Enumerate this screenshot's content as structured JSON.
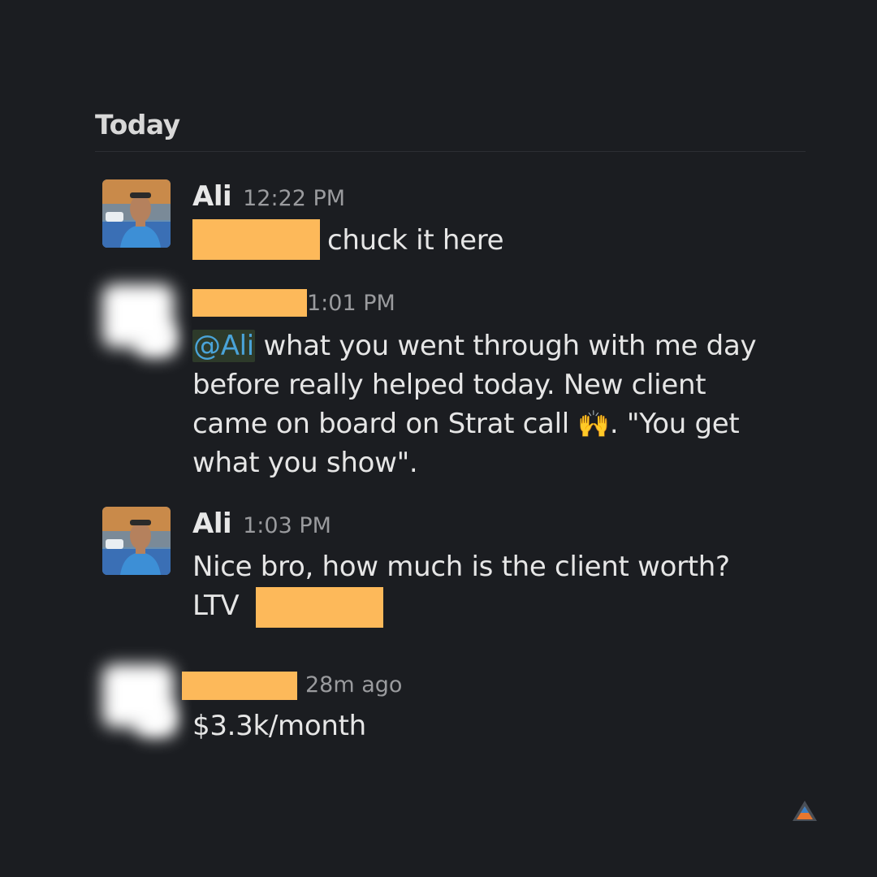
{
  "day_header": "Today",
  "messages": [
    {
      "author": "Ali",
      "time": "12:22 PM",
      "text_after_redaction": "chuck it here"
    },
    {
      "author": "",
      "time": "1:01 PM",
      "mention": "@Ali",
      "text_line1": " what you went through with me day",
      "text_line2": "before really helped today. New client",
      "text_line3a": "came on board on Strat call ",
      "emoji": "🙌",
      "text_line3b": ". \"You get",
      "text_line4": "what you show\"."
    },
    {
      "author": "Ali",
      "time": "1:03 PM",
      "text_line1": "Nice bro, how much is the client worth?",
      "text_line2": "LTV"
    },
    {
      "author": "",
      "time": "28m ago",
      "text": "$3.3k/month"
    }
  ],
  "colors": {
    "background": "#1b1d21",
    "redaction": "#fdb95a",
    "mention": "#4aa3d8"
  },
  "icons": {
    "logo": "triangle-logo-icon"
  }
}
